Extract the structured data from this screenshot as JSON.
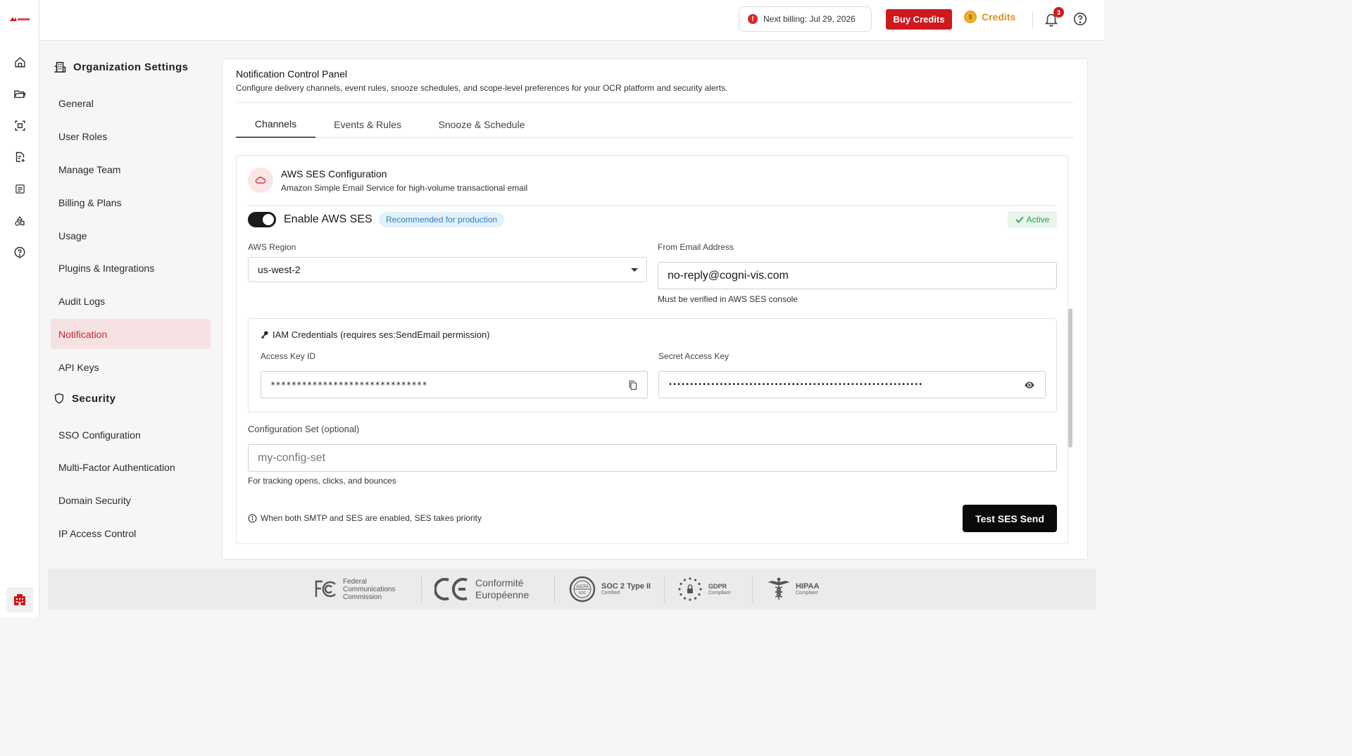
{
  "brand": {
    "accent": "#d0191f",
    "active_nav_bg": "#f6e2e3"
  },
  "rail": {
    "items": [
      "home-icon",
      "folder-icon",
      "scan-icon",
      "document-add-icon",
      "list-icon",
      "shapes-icon",
      "help-circle-icon"
    ],
    "bottom": "building-icon"
  },
  "topbar": {
    "billing": "Next billing: Jul 29, 2026",
    "buy_credits": "Buy Credits",
    "credits": "Credits",
    "notification_count": "3"
  },
  "settings_nav": {
    "org_heading": "Organization Settings",
    "org_items": [
      "General",
      "User Roles",
      "Manage Team",
      "Billing & Plans",
      "Usage",
      "Plugins & Integrations",
      "Audit Logs",
      "Notification",
      "API Keys"
    ],
    "security_heading": "Security",
    "security_items": [
      "SSO Configuration",
      "Multi-Factor Authentication",
      "Domain Security",
      "IP Access Control"
    ],
    "active": "Notification"
  },
  "panel": {
    "title": "Notification Control Panel",
    "subtitle": "Configure delivery channels, event rules, snooze schedules, and scope-level preferences for your OCR platform and security alerts.",
    "tabs": [
      "Channels",
      "Events & Rules",
      "Snooze & Schedule"
    ],
    "active_tab": "Channels"
  },
  "ses": {
    "title": "AWS SES Configuration",
    "subtitle": "Amazon Simple Email Service for high-volume transactional email",
    "enable_label": "Enable AWS SES",
    "enabled": true,
    "recommended_badge": "Recommended for production",
    "status_badge": "Active",
    "region_label": "AWS Region",
    "region_value": "us-west-2",
    "from_label": "From Email Address",
    "from_value": "no-reply@cogni-vis.com",
    "from_helper": "Must be verified in AWS SES console",
    "iam_title": "IAM Credentials (requires ses:SendEmail permission)",
    "access_key_label": "Access Key ID",
    "access_key_value": "******************************",
    "secret_key_label": "Secret Access Key",
    "secret_key_value": "••••••••••••••••••••••••••••••••••••••••••••••••••••••••••••",
    "config_set_label": "Configuration Set (optional)",
    "config_set_placeholder": "my-config-set",
    "config_set_helper": "For tracking opens, clicks, and bounces",
    "note": "When both SMTP and SES are enabled, SES takes priority",
    "test_button": "Test SES Send"
  },
  "footer": {
    "fcc_line1": "Federal",
    "fcc_line2": "Communications",
    "fcc_line3": "Commission",
    "ce_line1": "Conformité",
    "ce_line2": "Européenne",
    "soc_title": "SOC 2 Type II",
    "soc_sub": "Certified",
    "gdpr_title": "GDPR",
    "gdpr_sub": "Compliant",
    "hipaa_title": "HIPAA",
    "hipaa_sub": "Compliant"
  }
}
